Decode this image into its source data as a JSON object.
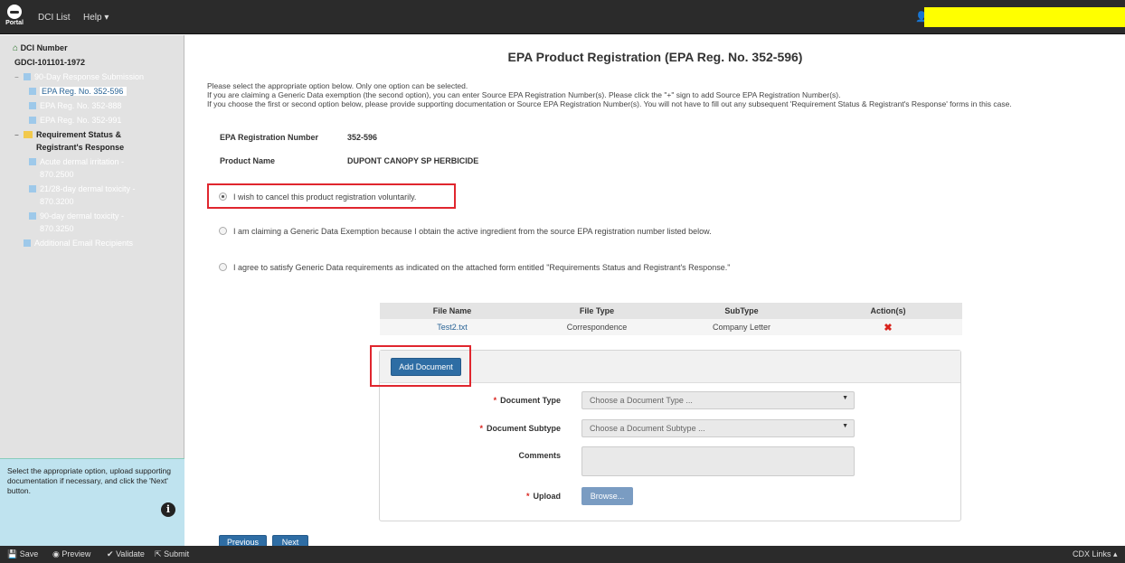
{
  "topbar": {
    "logo_text": "Portal",
    "nav": [
      "DCI List",
      "Help ▾"
    ],
    "user_icon": "user-icon"
  },
  "sidebar": {
    "root_label": "DCI Number",
    "root_value": "GDCI-101101-1972",
    "items": [
      "90-Day Response Submission",
      "EPA Reg. No. 352-596",
      "EPA Reg. No. 352-888",
      "EPA Reg. No. 352-991",
      "Requirement Status &",
      "Registrant's Response",
      "Acute dermal irritation -",
      "870.2500",
      "21/28-day dermal toxicity -",
      "870.3200",
      "90-day dermal toxicity -",
      "870.3250",
      "Additional Email Recipients"
    ],
    "help_text": "Select the appropriate option, upload supporting documentation if necessary, and click the 'Next' button."
  },
  "main": {
    "title": "EPA Product Registration (EPA Reg. No. 352-596)",
    "instructions": [
      "Please select the appropriate option below. Only one option can be selected.",
      "If you are claiming a Generic Data exemption (the second option), you can enter Source EPA Registration Number(s). Please click the \"+\" sign to add Source EPA Registration Number(s).",
      "If you choose the first or second option below, please provide supporting documentation or Source EPA Registration Number(s). You will not have to fill out any subsequent 'Requirement Status & Registrant's Response' forms in this case."
    ],
    "reg_label": "EPA Registration Number",
    "reg_value": "352-596",
    "product_label": "Product Name",
    "product_value": "DUPONT CANOPY SP HERBICIDE",
    "options": [
      "I wish to cancel this product registration voluntarily.",
      "I am claiming a Generic Data Exemption because I obtain the active ingredient from the source EPA registration number listed below.",
      "I agree to satisfy Generic Data requirements as indicated on the attached form entitled \"Requirements Status and Registrant's Response.\""
    ],
    "selected_option": 0
  },
  "files": {
    "headers": [
      "File Name",
      "File Type",
      "SubType",
      "Action(s)"
    ],
    "rows": [
      {
        "name": "Test2.txt",
        "type": "Correspondence",
        "subtype": "Company Letter",
        "action": "✖"
      }
    ]
  },
  "upload": {
    "add_button": "Add Document",
    "doc_type_label": "Document Type",
    "doc_type_placeholder": "Choose a Document Type ...",
    "doc_subtype_label": "Document Subtype",
    "doc_subtype_placeholder": "Choose a Document Subtype ...",
    "comments_label": "Comments",
    "upload_label": "Upload",
    "browse_label": "Browse...",
    "required_mark": "*"
  },
  "pager": {
    "previous": "Previous",
    "next": "Next"
  },
  "bottombar": {
    "save": "Save",
    "preview": "Preview",
    "validate": "Validate",
    "submit": "Submit",
    "cdx_links": "CDX Links ▴"
  },
  "colors": {
    "highlight": "#e0262e",
    "primary": "#2e6da4",
    "user_bar": "#ffff00"
  }
}
